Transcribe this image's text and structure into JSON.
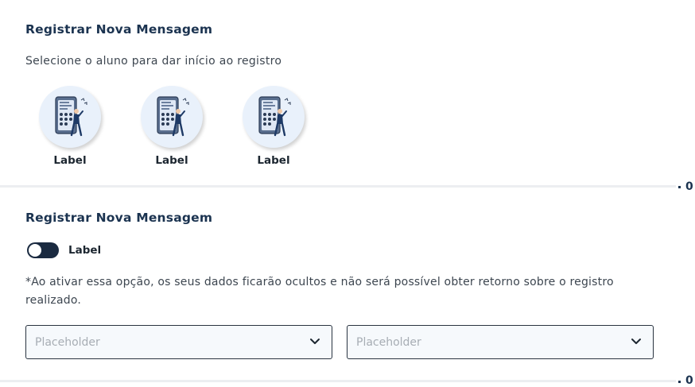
{
  "section1": {
    "title": "Registrar Nova Mensagem",
    "subtitle": "Selecione o aluno para dar início ao registro",
    "students": [
      {
        "label": "Label"
      },
      {
        "label": "Label"
      },
      {
        "label": "Label"
      }
    ],
    "counter": "0"
  },
  "section2": {
    "title": "Registrar Nova Mensagem",
    "toggle": {
      "label": "Label",
      "on": false
    },
    "note": "*Ao ativar essa opção, os seus dados ficarão ocultos e não será possível obter retorno sobre o registro realizado.",
    "selects": [
      {
        "placeholder": "Placeholder"
      },
      {
        "placeholder": "Placeholder"
      }
    ],
    "counter": "0"
  },
  "icons": {
    "avatar": "person-with-phone-illustration",
    "select": "chevron-down-icon"
  },
  "colors": {
    "title": "#1b3350",
    "avatar_bg": "#e9f1fb",
    "toggle_track": "#1a2a40"
  }
}
